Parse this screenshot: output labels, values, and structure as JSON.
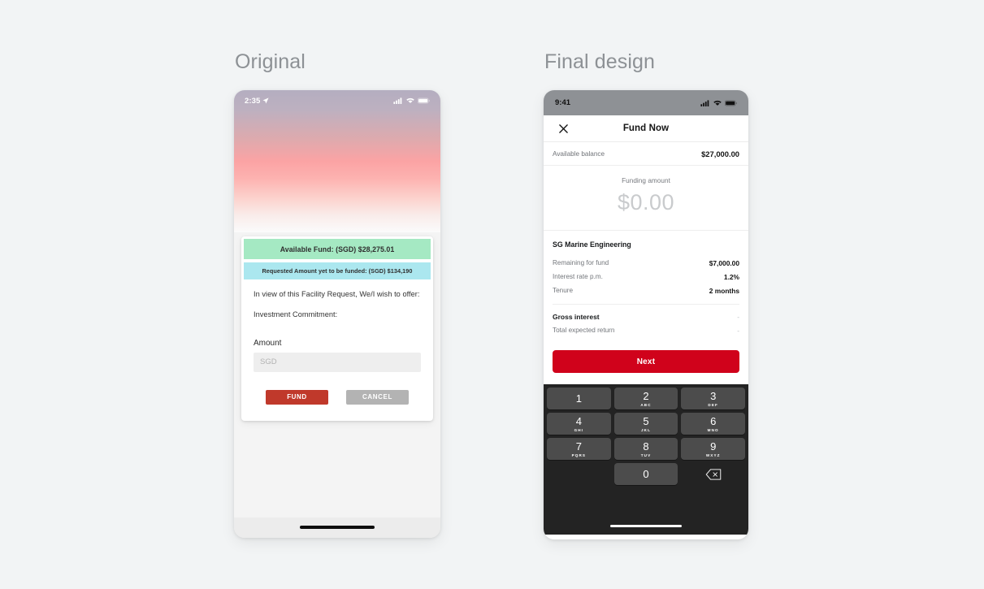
{
  "page": {
    "background_color": "#f2f4f5"
  },
  "columns": {
    "original_heading": "Original",
    "final_heading": "Final design"
  },
  "original_phone": {
    "status_bar": {
      "time": "2:35",
      "location_icon": "location-arrow-icon",
      "signal_icon": "cellular-signal-icon",
      "wifi_icon": "wifi-icon",
      "battery_icon": "battery-icon"
    },
    "card": {
      "available_fund_banner": "Available Fund: (SGD) $28,275.01",
      "available_fund_banner_color": "#a5e9c3",
      "requested_banner": "Requested Amount yet to be funded: (SGD) $134,190",
      "requested_banner_color": "#abe7ef",
      "paragraph_1": "In view of this Facility Request, We/I wish to offer:",
      "paragraph_2": "Investment Commitment:",
      "amount_label": "Amount",
      "amount_placeholder": "SGD",
      "amount_value": "",
      "fund_button": "FUND",
      "fund_button_color": "#c0392b",
      "cancel_button": "CANCEL",
      "cancel_button_color": "#b3b3b3"
    }
  },
  "final_phone": {
    "status_bar": {
      "time": "9:41",
      "signal_icon": "cellular-signal-icon",
      "wifi_icon": "wifi-icon",
      "battery_icon": "battery-icon",
      "background_color": "#8e9195"
    },
    "nav": {
      "close_icon": "close-icon",
      "title": "Fund Now"
    },
    "balance": {
      "label": "Available balance",
      "value": "$27,000.00"
    },
    "funding": {
      "label": "Funding amount",
      "value": "$0.00"
    },
    "details": {
      "title": "SG Marine Engineering",
      "rows": [
        {
          "label": "Remaining for fund",
          "value": "$7,000.00"
        },
        {
          "label": "Interest rate p.m.",
          "value": "1.2%"
        },
        {
          "label": "Tenure",
          "value": "2 months"
        }
      ],
      "summary": [
        {
          "label": "Gross interest",
          "value": "-"
        },
        {
          "label": "Total expected return",
          "value": "-"
        }
      ]
    },
    "next_button": {
      "label": "Next",
      "color": "#d0021b"
    },
    "keypad": {
      "keys": [
        {
          "num": "1",
          "abc": ""
        },
        {
          "num": "2",
          "abc": "ABC"
        },
        {
          "num": "3",
          "abc": "DEF"
        },
        {
          "num": "4",
          "abc": "GHI"
        },
        {
          "num": "5",
          "abc": "JKL"
        },
        {
          "num": "6",
          "abc": "MNO"
        },
        {
          "num": "7",
          "abc": "PQRS"
        },
        {
          "num": "8",
          "abc": "TUV"
        },
        {
          "num": "9",
          "abc": "WXYZ"
        },
        {
          "num": "0",
          "abc": ""
        }
      ],
      "backspace_icon": "backspace-icon",
      "background_color": "#232323",
      "key_color": "#4c4c4c"
    }
  }
}
